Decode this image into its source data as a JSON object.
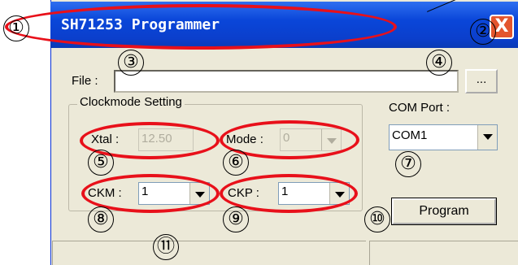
{
  "window": {
    "title": "SH71253 Programmer",
    "close_glyph": "X"
  },
  "file": {
    "label": "File :",
    "value": "",
    "browse_label": "..."
  },
  "clockmode": {
    "group_title": "Clockmode Setting",
    "xtal_label": "Xtal :",
    "xtal_value": "12.50",
    "mode_label": "Mode :",
    "mode_value": "0",
    "ckm_label": "CKM :",
    "ckm_value": "1",
    "ckp_label": "CKP :",
    "ckp_value": "1"
  },
  "com": {
    "label": "COM Port :",
    "value": "COM1"
  },
  "program_button": "Program",
  "annotations": [
    "①",
    "②",
    "③",
    "④",
    "⑤",
    "⑥",
    "⑦",
    "⑧",
    "⑨",
    "⑩",
    "⑪"
  ],
  "colors": {
    "title_bar": "#0a46d9",
    "annotation": "#e8101a",
    "window_bg": "#ece9d8"
  }
}
